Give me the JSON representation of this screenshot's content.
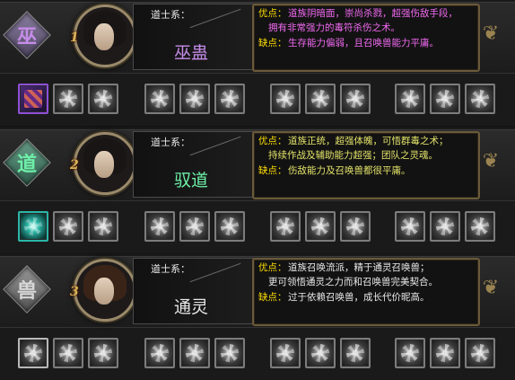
{
  "labels": {
    "system": "道士系：",
    "pros": "优点：",
    "cons": "缺点："
  },
  "colors": {
    "label": "#ffde00",
    "text_wu": "#f06af0",
    "text_dao": "#e2e26a",
    "text_shou": "#e8e8e8",
    "accent_wu": "#b07ad8",
    "accent_dao": "#5fe0a0",
    "accent_shou": "#bfbfbf"
  },
  "classes": [
    {
      "rank": "1",
      "emblem": "巫",
      "name": "巫蛊",
      "pros_line1": "道族阴暗面，崇尚杀戮，超强伤敌手段，",
      "pros_line2": "拥有非常强力的毒符杀伤之术。",
      "cons": "生存能力偏弱，且召唤兽能力平庸。",
      "skills": [
        "poison-talisman-icon",
        "stone-skill-icon",
        "stone-skill-icon",
        "light-burst-icon",
        "light-burst-icon",
        "light-burst-icon",
        "sun-rune-icon",
        "sun-rune-icon",
        "sun-rune-icon",
        "figure-summon-icon",
        "figure-summon-icon",
        "figure-summon-icon"
      ]
    },
    {
      "rank": "2",
      "emblem": "道",
      "name": "驭道",
      "pros_line1": "道族正统，超强体魄，可悟群毒之术；",
      "pros_line2": "持续作战及辅助能力超强；团队之灵魂。",
      "cons": "伤敌能力及召唤兽都很平庸。",
      "skills": [
        "spirit-aura-icon",
        "spirit-aura-icon",
        "spirit-aura-icon",
        "star-burst-icon",
        "star-burst-icon",
        "star-burst-icon",
        "sword-rain-icon",
        "sword-rain-icon",
        "sword-rain-icon",
        "tree-spirit-icon",
        "tree-spirit-icon",
        "tree-spirit-icon"
      ]
    },
    {
      "rank": "3",
      "emblem": "兽",
      "name": "通灵",
      "pros_line1": "道族召唤流派，精于通灵召唤兽；",
      "pros_line2": "更可领悟通灵之力而和召唤兽完美契合。",
      "cons": "过于依赖召唤兽，成长代价昵高。",
      "skills": [
        "beast-summon-icon",
        "beast-summon-icon",
        "beast-summon-icon",
        "guardian-icon",
        "guardian-icon",
        "guardian-icon",
        "ring-portal-icon",
        "ring-portal-icon",
        "ring-portal-icon",
        "muscle-beast-icon",
        "muscle-beast-icon",
        "muscle-beast-icon"
      ]
    }
  ]
}
